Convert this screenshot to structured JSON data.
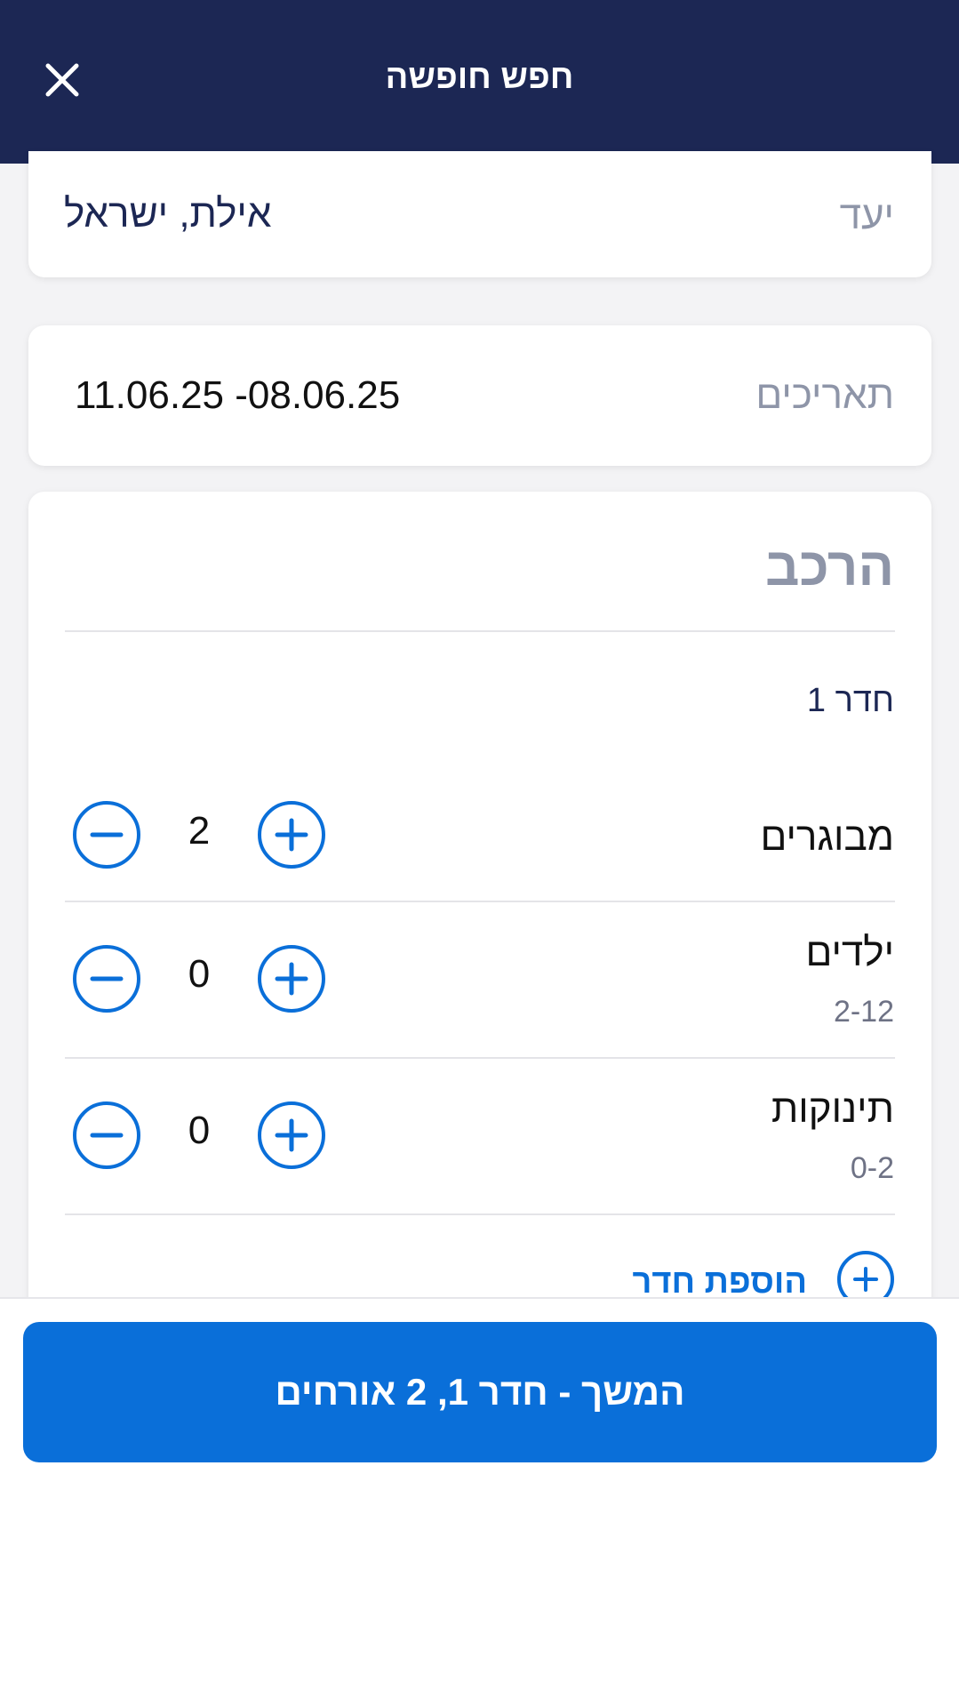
{
  "header": {
    "title": "חפש חופשה",
    "close_icon": "close-icon"
  },
  "destination": {
    "label": "יעד",
    "value": "אילת, ישראל"
  },
  "dates": {
    "label": "תאריכים",
    "value": "08.06.25- 11.06.25"
  },
  "composition": {
    "title": "הרכב",
    "room_label": "חדר 1",
    "rows": [
      {
        "label": "מבוגרים",
        "sub": "",
        "count": "2"
      },
      {
        "label": "ילדים",
        "sub": "2-12",
        "count": "0"
      },
      {
        "label": "תינוקות",
        "sub": "0-2",
        "count": "0"
      }
    ],
    "add_room_label": "הוספת חדר"
  },
  "footer": {
    "continue_label": "המשך - חדר 1, 2 אורחים"
  },
  "colors": {
    "header_bg": "#1c2754",
    "accent": "#0a6fd9",
    "muted": "#8e95a8"
  }
}
